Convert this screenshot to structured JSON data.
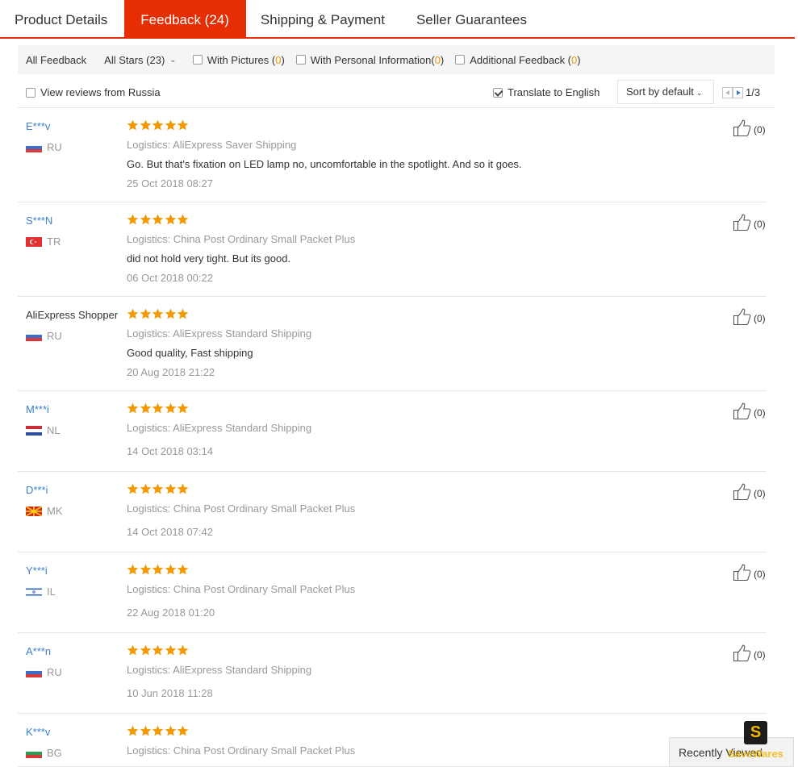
{
  "tabs": [
    {
      "label": "Product Details",
      "active": false
    },
    {
      "label": "Feedback (24)",
      "active": true
    },
    {
      "label": "Shipping & Payment",
      "active": false
    },
    {
      "label": "Seller Guarantees",
      "active": false
    }
  ],
  "filters": {
    "all_feedback": "All Feedback",
    "all_stars": "All Stars (23)",
    "with_pictures_label": "With Pictures (",
    "with_pictures_count": "0",
    "with_personal_label": "With Personal Information(",
    "with_personal_count": "0",
    "additional_label": "Additional Feedback (",
    "additional_count": "0",
    "close_paren": ")"
  },
  "options": {
    "russia_label": "View reviews from Russia",
    "russia_checked": false,
    "translate_label": "Translate to English",
    "translate_checked": true,
    "sort_label": "Sort by default",
    "page": "1/3"
  },
  "colors": {
    "accent": "#e62e04",
    "link": "#3c7fce",
    "star": "#f39800",
    "muted": "#999999"
  },
  "reviews": [
    {
      "name": "E***v",
      "country": "RU",
      "rating": 5,
      "logistics": "Logistics: AliExpress Saver Shipping",
      "text": "Go. But that's fixation on LED lamp no, uncomfortable in the spotlight. And so it goes.",
      "date": "25 Oct 2018 08:27",
      "helpful": "(0)"
    },
    {
      "name": "S***N",
      "country": "TR",
      "rating": 5,
      "logistics": "Logistics: China Post Ordinary Small Packet Plus",
      "text": "did not hold very tight. But its good.",
      "date": "06 Oct 2018 00:22",
      "helpful": "(0)"
    },
    {
      "name": "AliExpress Shopper",
      "country": "RU",
      "rating": 5,
      "logistics": "Logistics: AliExpress Standard Shipping",
      "text": "Good quality, Fast shipping",
      "date": "20 Aug 2018 21:22",
      "helpful": "(0)"
    },
    {
      "name": "M***i",
      "country": "NL",
      "rating": 5,
      "logistics": "Logistics: AliExpress Standard Shipping",
      "text": "",
      "date": "14 Oct 2018 03:14",
      "helpful": "(0)"
    },
    {
      "name": "D***i",
      "country": "MK",
      "rating": 5,
      "logistics": "Logistics: China Post Ordinary Small Packet Plus",
      "text": "",
      "date": "14 Oct 2018 07:42",
      "helpful": "(0)"
    },
    {
      "name": "Y***i",
      "country": "IL",
      "rating": 5,
      "logistics": "Logistics: China Post Ordinary Small Packet Plus",
      "text": "",
      "date": "22 Aug 2018 01:20",
      "helpful": "(0)"
    },
    {
      "name": "A***n",
      "country": "RU",
      "rating": 5,
      "logistics": "Logistics: AliExpress Standard Shipping",
      "text": "",
      "date": "10 Jun 2018 11:28",
      "helpful": "(0)"
    },
    {
      "name": "K***v",
      "country": "BG",
      "rating": 5,
      "logistics": "Logistics: China Post Ordinary Small Packet Plus",
      "text": "",
      "date": "",
      "helpful": ""
    }
  ],
  "recently_viewed": "Recently Viewed",
  "watermark": {
    "logo": "S",
    "text": "SaveWares"
  }
}
